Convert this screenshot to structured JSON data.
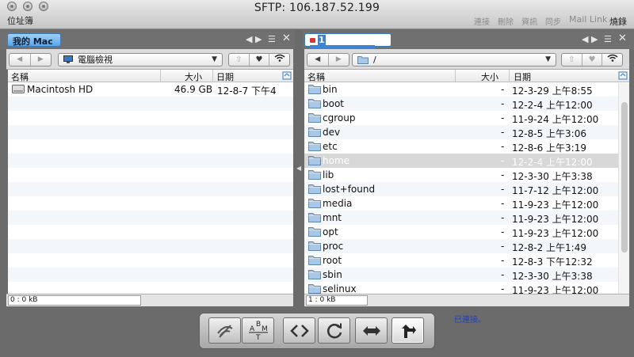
{
  "window": {
    "title": "SFTP: 106.187.52.199",
    "bookmarks_label": "位址簿",
    "actions": [
      "連接",
      "刪除",
      "資訊",
      "同步",
      "Mail Link"
    ],
    "eject_label": "燒錄"
  },
  "left_pane": {
    "tab_label": "我的 Mac",
    "location": "電腦檢視",
    "columns": {
      "name": "名稱",
      "size": "大小",
      "date": "日期"
    },
    "rows": [
      {
        "name": "Macintosh HD",
        "size": "46.9 GB",
        "date": "12-8-7 下午4"
      }
    ],
    "status": "0 : 0 kB"
  },
  "right_pane": {
    "tab_label": "1",
    "location": "/",
    "columns": {
      "name": "名稱",
      "size": "大小",
      "date": "日期"
    },
    "rows": [
      {
        "name": "bin",
        "size": "-",
        "date": "12-3-29 上午8:55"
      },
      {
        "name": "boot",
        "size": "-",
        "date": "12-2-4 上午12:00"
      },
      {
        "name": "cgroup",
        "size": "-",
        "date": "11-9-24 上午12:00"
      },
      {
        "name": "dev",
        "size": "-",
        "date": "12-8-5 上午3:06"
      },
      {
        "name": "etc",
        "size": "-",
        "date": "12-8-6 上午3:19"
      },
      {
        "name": "home",
        "size": "-",
        "date": "12-2-4 上午12:00"
      },
      {
        "name": "lib",
        "size": "-",
        "date": "12-3-30 上午3:38"
      },
      {
        "name": "lost+found",
        "size": "-",
        "date": "11-7-12 上午12:00"
      },
      {
        "name": "media",
        "size": "-",
        "date": "11-9-23 上午12:00"
      },
      {
        "name": "mnt",
        "size": "-",
        "date": "11-9-23 上午12:00"
      },
      {
        "name": "opt",
        "size": "-",
        "date": "11-9-23 上午12:00"
      },
      {
        "name": "proc",
        "size": "-",
        "date": "12-8-2 上午1:49"
      },
      {
        "name": "root",
        "size": "-",
        "date": "12-8-3 下午12:32"
      },
      {
        "name": "sbin",
        "size": "-",
        "date": "12-3-30 上午3:38"
      },
      {
        "name": "selinux",
        "size": "-",
        "date": "11-9-23 上午12:00"
      }
    ],
    "highlighted_row": "home",
    "status": "1 : 0 kB"
  },
  "bottom_toolbar": {
    "buttons": [
      "no-connection-icon",
      "text-mode-icon",
      "code-icon",
      "refresh-icon",
      "swap-icon",
      "transfer-icon"
    ],
    "status_text": "已連接。"
  }
}
